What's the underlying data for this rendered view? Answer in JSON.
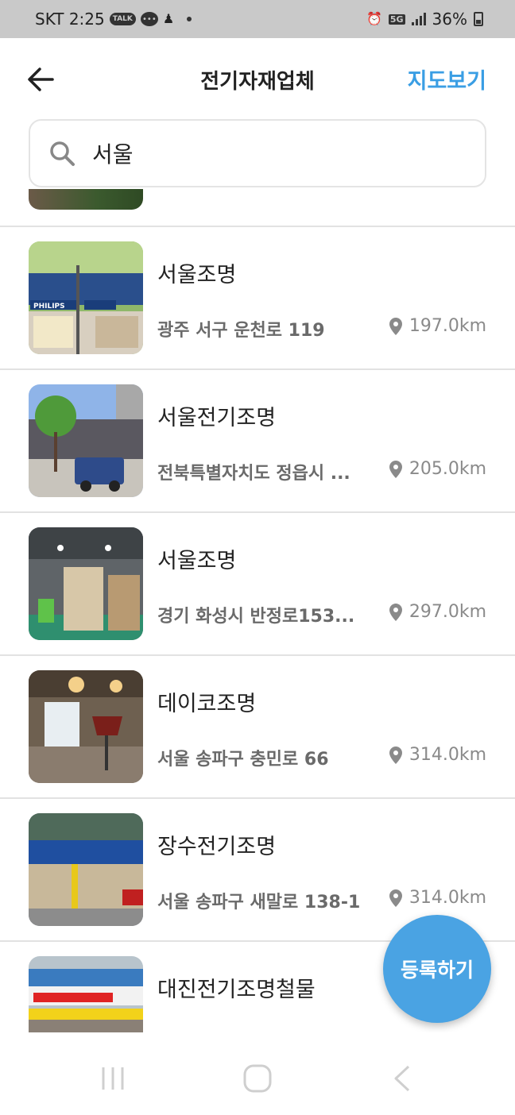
{
  "status_bar": {
    "carrier_time": "SKT 2:25",
    "talk_badge": "TALK",
    "network": "5G",
    "battery": "36%",
    "icons": [
      "kakaotalk-icon",
      "chat-bubble-icon",
      "figure-icon",
      "dot-icon",
      "alarm-icon",
      "5g-icon",
      "signal-icon",
      "battery-icon"
    ]
  },
  "header": {
    "title": "전기자재업체",
    "map_link": "지도보기",
    "back_icon": "back-arrow-icon"
  },
  "search": {
    "value": "서울",
    "icon": "search-icon"
  },
  "list": {
    "items": [
      {
        "name": "서울조명",
        "address": "광주 서구 운천로 119",
        "distance": "197.0km"
      },
      {
        "name": "서울전기조명",
        "address": "전북특별자치도 정읍시 ...",
        "distance": "205.0km"
      },
      {
        "name": "서울조명",
        "address": "경기 화성시 반정로153...",
        "distance": "297.0km"
      },
      {
        "name": "데이코조명",
        "address": "서울 송파구 충민로 66",
        "distance": "314.0km"
      },
      {
        "name": "장수전기조명",
        "address": "서울 송파구 새말로 138-1",
        "distance": "314.0km"
      },
      {
        "name": "대진전기조명철물",
        "address": "",
        "distance": ""
      }
    ]
  },
  "fab": {
    "label": "등록하기"
  },
  "nav": {
    "icons": [
      "recent-apps-icon",
      "home-icon",
      "back-icon"
    ]
  },
  "colors": {
    "accent": "#3a9ee4",
    "fab": "#4aa3e3",
    "status_bar": "#c9c9c9"
  }
}
